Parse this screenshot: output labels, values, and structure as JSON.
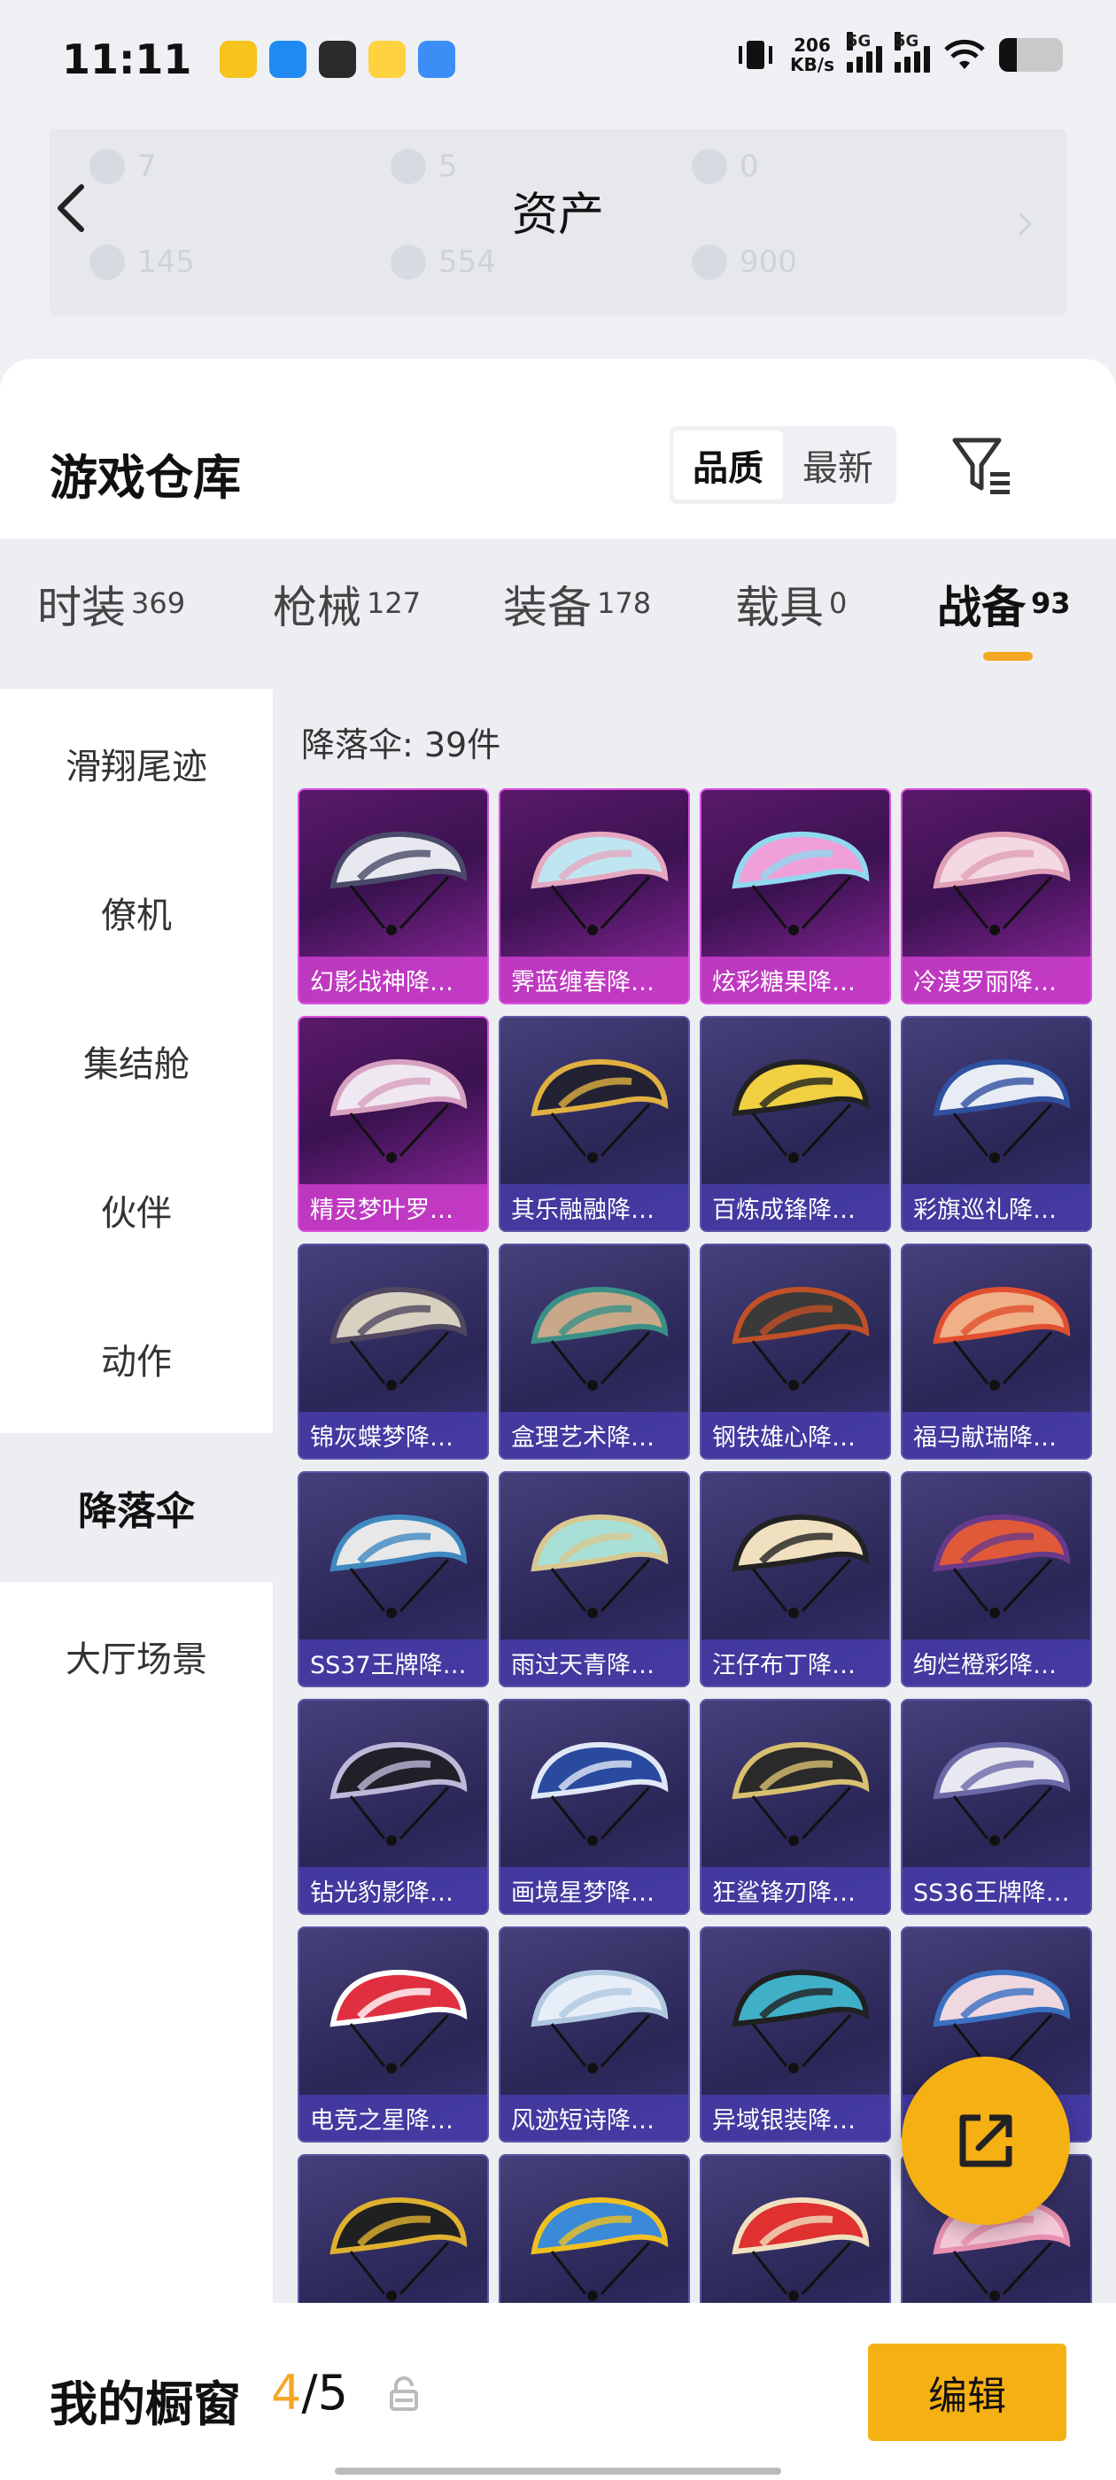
{
  "status_bar": {
    "time": "11:11",
    "net_speed_value": "206",
    "net_speed_unit": "KB/s",
    "signal_1_label": "5G",
    "signal_2_label": "5G",
    "app_icon_colors": [
      "#f7c31c",
      "#1f8bf2",
      "#2b2b2b",
      "#ffd23f",
      "#3a8ef6"
    ]
  },
  "header": {
    "title": "资产",
    "ghost_values_row1": [
      "7",
      "5",
      "0"
    ],
    "ghost_values_row2": [
      "145",
      "554",
      "900"
    ]
  },
  "warehouse": {
    "title": "游戏仓库",
    "sort_options": [
      "品质",
      "最新"
    ],
    "sort_active": "品质"
  },
  "tabs": [
    {
      "label": "时装",
      "count": "369"
    },
    {
      "label": "枪械",
      "count": "127"
    },
    {
      "label": "装备",
      "count": "178"
    },
    {
      "label": "载具",
      "count": "0"
    },
    {
      "label": "战备",
      "count": "93"
    }
  ],
  "active_tab": "战备",
  "sidebar": {
    "items": [
      "滑翔尾迹",
      "僚机",
      "集结舱",
      "伙伴",
      "动作",
      "降落伞",
      "大厅场景"
    ],
    "active": "降落伞"
  },
  "content": {
    "count_label": "降落伞: 39件",
    "items": [
      {
        "name": "幻影战神降…",
        "tier": "purple",
        "colors": [
          "#e8e8f0",
          "#4a4a6a"
        ]
      },
      {
        "name": "霁蓝缠春降…",
        "tier": "purple",
        "colors": [
          "#bfe6f0",
          "#e6a8c0"
        ]
      },
      {
        "name": "炫彩糖果降…",
        "tier": "purple",
        "colors": [
          "#f0a0d8",
          "#90d8f0"
        ]
      },
      {
        "name": "冷漠罗丽降…",
        "tier": "purple",
        "colors": [
          "#f4d8e4",
          "#e0a0b8"
        ]
      },
      {
        "name": "精灵梦叶罗…",
        "tier": "purple",
        "colors": [
          "#f0e8f0",
          "#d8a0c0"
        ]
      },
      {
        "name": "其乐融融降…",
        "tier": "blue",
        "colors": [
          "#222233",
          "#e0b040"
        ]
      },
      {
        "name": "百炼成锋降…",
        "tier": "blue",
        "colors": [
          "#f0d040",
          "#222222"
        ]
      },
      {
        "name": "彩旗巡礼降…",
        "tier": "blue",
        "colors": [
          "#e8ecf4",
          "#3050a0"
        ]
      },
      {
        "name": "锦灰蝶梦降…",
        "tier": "blue",
        "colors": [
          "#d8d0c0",
          "#504860"
        ]
      },
      {
        "name": "盒理艺术降…",
        "tier": "blue",
        "colors": [
          "#c8a888",
          "#3a9088"
        ]
      },
      {
        "name": "钢铁雄心降…",
        "tier": "blue",
        "colors": [
          "#3a3a3a",
          "#c05028"
        ]
      },
      {
        "name": "福马献瑞降…",
        "tier": "blue",
        "colors": [
          "#f0b088",
          "#e05030"
        ]
      },
      {
        "name": "SS37王牌降…",
        "tier": "blue",
        "colors": [
          "#e8e8e8",
          "#4088c0"
        ]
      },
      {
        "name": "雨过天青降…",
        "tier": "blue",
        "colors": [
          "#a8e0d8",
          "#d8c890"
        ]
      },
      {
        "name": "汪仔布丁降…",
        "tier": "blue",
        "colors": [
          "#f0e0c0",
          "#222222"
        ]
      },
      {
        "name": "绚烂橙彩降…",
        "tier": "blue",
        "colors": [
          "#e05a3a",
          "#6a3a8a"
        ]
      },
      {
        "name": "钻光豹影降…",
        "tier": "blue",
        "colors": [
          "#202028",
          "#c0b8d8"
        ]
      },
      {
        "name": "画境星梦降…",
        "tier": "blue",
        "colors": [
          "#2a4aa0",
          "#e0e8f8"
        ]
      },
      {
        "name": "狂鲨锋刃降…",
        "tier": "blue",
        "colors": [
          "#2a2a2a",
          "#d8c070"
        ]
      },
      {
        "name": "SS36王牌降…",
        "tier": "blue",
        "colors": [
          "#e8e8f0",
          "#6a6aa8"
        ]
      },
      {
        "name": "电竞之星降…",
        "tier": "blue",
        "colors": [
          "#e03040",
          "#ffffff"
        ]
      },
      {
        "name": "风迹短诗降…",
        "tier": "blue",
        "colors": [
          "#e8eef8",
          "#b0c8e0"
        ]
      },
      {
        "name": "异域银装降…",
        "tier": "blue",
        "colors": [
          "#40b0c8",
          "#202020"
        ]
      },
      {
        "name": "",
        "tier": "blue",
        "colors": [
          "#f0d8e0",
          "#3a70c0"
        ]
      },
      {
        "name": "",
        "tier": "blue",
        "colors": [
          "#202020",
          "#e0b030"
        ]
      },
      {
        "name": "",
        "tier": "blue",
        "colors": [
          "#3a8ad8",
          "#f0c020"
        ]
      },
      {
        "name": "",
        "tier": "blue",
        "colors": [
          "#e03030",
          "#f0e0c0"
        ]
      },
      {
        "name": "",
        "tier": "blue",
        "colors": [
          "#f4c8d8",
          "#e890b0"
        ]
      }
    ]
  },
  "showcase": {
    "label": "我的橱窗",
    "current": "4",
    "separator": "/",
    "max": "5",
    "edit_label": "编辑"
  },
  "colors": {
    "accent": "#f5b014",
    "tab_underline": "#f5a623",
    "purple_border": "#d94fe0",
    "blue_border": "#5c56a8"
  }
}
